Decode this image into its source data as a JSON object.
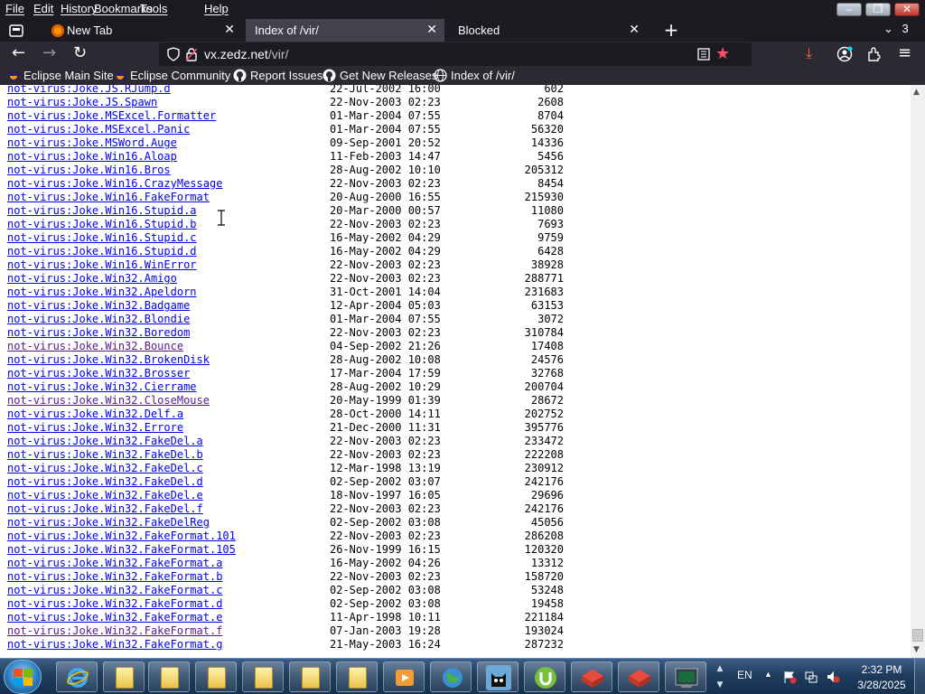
{
  "menu": [
    "File",
    "Edit",
    "History",
    "Bookmarks",
    "Tools",
    "Help"
  ],
  "tabs": [
    {
      "title": "New Tab",
      "icon": "firefox-new-tab-icon",
      "active": false
    },
    {
      "title": "Index of /vir/",
      "icon": "",
      "active": true
    },
    {
      "title": "Blocked",
      "icon": "",
      "active": false
    }
  ],
  "tab_overflow_count": "3",
  "address": {
    "domain": "vx.zedz.net",
    "path": "/vir/"
  },
  "bookmarks": [
    {
      "label": "Eclipse Main Site",
      "icon": "eclipse-icon"
    },
    {
      "label": "Eclipse Community",
      "icon": "eclipse-icon"
    },
    {
      "label": "Report Issues",
      "icon": "github-icon"
    },
    {
      "label": "Get New Releases",
      "icon": "github-icon"
    },
    {
      "label": "Index of /vir/",
      "icon": "globe-icon"
    }
  ],
  "listing": [
    {
      "name": "not-virus:Joke.JS.RJump.d",
      "date": "22-Jul-2002 16:00",
      "size": "602",
      "visited": false
    },
    {
      "name": "not-virus:Joke.JS.Spawn",
      "date": "22-Nov-2003 02:23",
      "size": "2608",
      "visited": false
    },
    {
      "name": "not-virus:Joke.MSExcel.Formatter",
      "date": "01-Mar-2004 07:55",
      "size": "8704",
      "visited": false
    },
    {
      "name": "not-virus:Joke.MSExcel.Panic",
      "date": "01-Mar-2004 07:55",
      "size": "56320",
      "visited": false
    },
    {
      "name": "not-virus:Joke.MSWord.Auge",
      "date": "09-Sep-2001 20:52",
      "size": "14336",
      "visited": false
    },
    {
      "name": "not-virus:Joke.Win16.Aloap",
      "date": "11-Feb-2003 14:47",
      "size": "5456",
      "visited": false
    },
    {
      "name": "not-virus:Joke.Win16.Bros",
      "date": "28-Aug-2002 10:10",
      "size": "205312",
      "visited": false
    },
    {
      "name": "not-virus:Joke.Win16.CrazyMessage",
      "date": "22-Nov-2003 02:23",
      "size": "8454",
      "visited": false
    },
    {
      "name": "not-virus:Joke.Win16.FakeFormat",
      "date": "20-Aug-2000 16:55",
      "size": "215930",
      "visited": false
    },
    {
      "name": "not-virus:Joke.Win16.Stupid.a",
      "date": "20-Mar-2000 00:57",
      "size": "11080",
      "visited": false
    },
    {
      "name": "not-virus:Joke.Win16.Stupid.b",
      "date": "22-Nov-2003 02:23",
      "size": "7693",
      "visited": false
    },
    {
      "name": "not-virus:Joke.Win16.Stupid.c",
      "date": "16-May-2002 04:29",
      "size": "9759",
      "visited": false
    },
    {
      "name": "not-virus:Joke.Win16.Stupid.d",
      "date": "16-May-2002 04:29",
      "size": "6428",
      "visited": false
    },
    {
      "name": "not-virus:Joke.Win16.WinError",
      "date": "22-Nov-2003 02:23",
      "size": "38928",
      "visited": false
    },
    {
      "name": "not-virus:Joke.Win32.Amigo",
      "date": "22-Nov-2003 02:23",
      "size": "288771",
      "visited": false
    },
    {
      "name": "not-virus:Joke.Win32.Apeldorn",
      "date": "31-Oct-2001 14:04",
      "size": "231683",
      "visited": false
    },
    {
      "name": "not-virus:Joke.Win32.Badgame",
      "date": "12-Apr-2004 05:03",
      "size": "63153",
      "visited": false
    },
    {
      "name": "not-virus:Joke.Win32.Blondie",
      "date": "01-Mar-2004 07:55",
      "size": "3072",
      "visited": false
    },
    {
      "name": "not-virus:Joke.Win32.Boredom",
      "date": "22-Nov-2003 02:23",
      "size": "310784",
      "visited": false
    },
    {
      "name": "not-virus:Joke.Win32.Bounce",
      "date": "04-Sep-2002 21:26",
      "size": "17408",
      "visited": true
    },
    {
      "name": "not-virus:Joke.Win32.BrokenDisk",
      "date": "28-Aug-2002 10:08",
      "size": "24576",
      "visited": false
    },
    {
      "name": "not-virus:Joke.Win32.Brosser",
      "date": "17-Mar-2004 17:59",
      "size": "32768",
      "visited": false
    },
    {
      "name": "not-virus:Joke.Win32.Cierrame",
      "date": "28-Aug-2002 10:29",
      "size": "200704",
      "visited": false
    },
    {
      "name": "not-virus:Joke.Win32.CloseMouse",
      "date": "20-May-1999 01:39",
      "size": "28672",
      "visited": true
    },
    {
      "name": "not-virus:Joke.Win32.Delf.a",
      "date": "28-Oct-2000 14:11",
      "size": "202752",
      "visited": false
    },
    {
      "name": "not-virus:Joke.Win32.Errore",
      "date": "21-Dec-2000 11:31",
      "size": "395776",
      "visited": false
    },
    {
      "name": "not-virus:Joke.Win32.FakeDel.a",
      "date": "22-Nov-2003 02:23",
      "size": "233472",
      "visited": false
    },
    {
      "name": "not-virus:Joke.Win32.FakeDel.b",
      "date": "22-Nov-2003 02:23",
      "size": "222208",
      "visited": false
    },
    {
      "name": "not-virus:Joke.Win32.FakeDel.c",
      "date": "12-Mar-1998 13:19",
      "size": "230912",
      "visited": false
    },
    {
      "name": "not-virus:Joke.Win32.FakeDel.d",
      "date": "02-Sep-2002 03:07",
      "size": "242176",
      "visited": false
    },
    {
      "name": "not-virus:Joke.Win32.FakeDel.e",
      "date": "18-Nov-1997 16:05",
      "size": "29696",
      "visited": false
    },
    {
      "name": "not-virus:Joke.Win32.FakeDel.f",
      "date": "22-Nov-2003 02:23",
      "size": "242176",
      "visited": false
    },
    {
      "name": "not-virus:Joke.Win32.FakeDelReg",
      "date": "02-Sep-2002 03:08",
      "size": "45056",
      "visited": false
    },
    {
      "name": "not-virus:Joke.Win32.FakeFormat.101",
      "date": "22-Nov-2003 02:23",
      "size": "286208",
      "visited": false
    },
    {
      "name": "not-virus:Joke.Win32.FakeFormat.105",
      "date": "26-Nov-1999 16:15",
      "size": "120320",
      "visited": false
    },
    {
      "name": "not-virus:Joke.Win32.FakeFormat.a",
      "date": "16-May-2002 04:26",
      "size": "13312",
      "visited": false
    },
    {
      "name": "not-virus:Joke.Win32.FakeFormat.b",
      "date": "22-Nov-2003 02:23",
      "size": "158720",
      "visited": false
    },
    {
      "name": "not-virus:Joke.Win32.FakeFormat.c",
      "date": "02-Sep-2002 03:08",
      "size": "53248",
      "visited": false
    },
    {
      "name": "not-virus:Joke.Win32.FakeFormat.d",
      "date": "02-Sep-2002 03:08",
      "size": "19458",
      "visited": false
    },
    {
      "name": "not-virus:Joke.Win32.FakeFormat.e",
      "date": "11-Apr-1998 10:11",
      "size": "221184",
      "visited": false
    },
    {
      "name": "not-virus:Joke.Win32.FakeFormat.f",
      "date": "07-Jan-2003 19:28",
      "size": "193024",
      "visited": true
    },
    {
      "name": "not-virus:Joke.Win32.FakeFormat.g",
      "date": "21-May-2003 16:24",
      "size": "287232",
      "visited": false
    }
  ],
  "taskbar": {
    "language": "EN",
    "time": "2:32 PM",
    "date": "3/28/2025",
    "items": [
      "internet-explorer-icon",
      "folder-icon",
      "folder-icon",
      "folder-icon",
      "folder-icon",
      "folder-icon",
      "folder-icon",
      "media-player-icon",
      "globe-app-icon",
      "cat-app-icon",
      "utorrent-icon",
      "red-box-app-icon",
      "red-box-app-icon",
      "terminal-app-icon"
    ]
  },
  "colors": {
    "link": "#0000ee",
    "visited": "#551a8b",
    "chrome_dark": "#1c1b22",
    "toolbar": "#2b2a33",
    "bookmark_star": "#ff4f5e"
  }
}
